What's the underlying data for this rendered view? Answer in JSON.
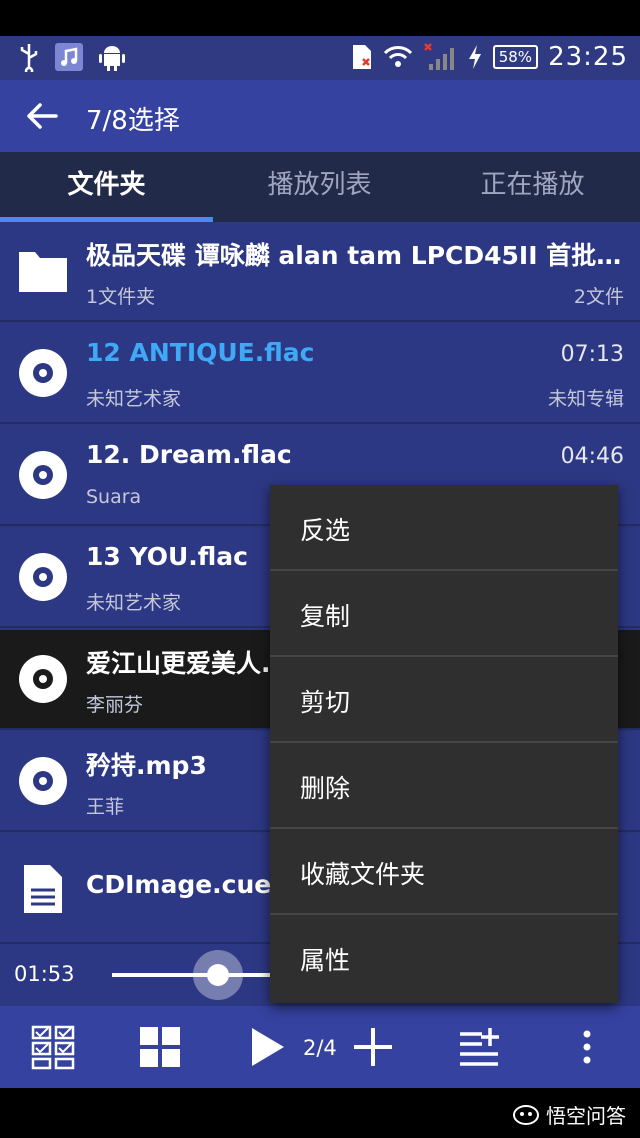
{
  "status_bar": {
    "battery": "58%",
    "clock": "23:25",
    "icons": [
      "usb-icon",
      "music-icon",
      "android-icon",
      "sim-icon",
      "wifi-icon",
      "signal-icon",
      "charging-icon"
    ]
  },
  "app_bar": {
    "title": "7/8选择"
  },
  "tabs": [
    {
      "label": "文件夹",
      "active": true
    },
    {
      "label": "播放列表",
      "active": false
    },
    {
      "label": "正在播放",
      "active": false
    }
  ],
  "rows": [
    {
      "type": "folder",
      "title": "极品天碟 谭咏麟 alan tam LPCD45II 首批…",
      "subtitle": "1文件夹",
      "right_top": "",
      "right_bottom": "2文件"
    },
    {
      "type": "music",
      "title": "12 ANTIQUE.flac",
      "subtitle": "未知艺术家",
      "right_top": "07:13",
      "right_bottom": "未知专辑",
      "highlight": true
    },
    {
      "type": "music",
      "title": "12. Dream.flac",
      "subtitle": "Suara",
      "right_top": "04:46",
      "right_bottom": ""
    },
    {
      "type": "music",
      "title": "13 YOU.flac",
      "subtitle": "未知艺术家",
      "right_top": "",
      "right_bottom": ""
    },
    {
      "type": "music",
      "title": "爱江山更爱美人.mp3",
      "subtitle": "李丽芬",
      "right_top": "",
      "right_bottom": "",
      "selected": true
    },
    {
      "type": "music",
      "title": "矜持.mp3",
      "subtitle": "王菲",
      "right_top": "",
      "right_bottom": ""
    },
    {
      "type": "file",
      "title": "CDImage.cue",
      "subtitle": "",
      "right_top": "",
      "right_bottom": ""
    }
  ],
  "player": {
    "elapsed": "01:53",
    "progress": 0.3
  },
  "bottom_bar": {
    "counter": "2/4"
  },
  "context_menu": [
    "反选",
    "复制",
    "剪切",
    "删除",
    "收藏文件夹",
    "属性"
  ],
  "watermark": "悟空问答"
}
